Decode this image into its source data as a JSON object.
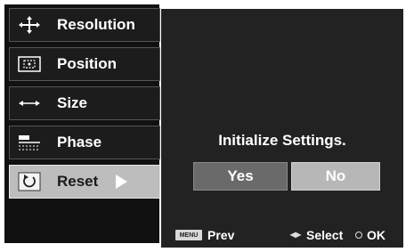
{
  "menu": {
    "items": [
      {
        "label": "Resolution",
        "icon": "resolution-icon"
      },
      {
        "label": "Position",
        "icon": "position-icon"
      },
      {
        "label": "Size",
        "icon": "size-icon"
      },
      {
        "label": "Phase",
        "icon": "phase-icon"
      },
      {
        "label": "Reset",
        "icon": "reset-icon",
        "selected": true
      }
    ]
  },
  "dialog": {
    "message": "Initialize Settings.",
    "yes_label": "Yes",
    "no_label": "No"
  },
  "footer": {
    "menu_key": "MENU",
    "prev_label": "Prev",
    "select_label": "Select",
    "ok_label": "OK"
  },
  "colors": {
    "menu_bg": "#111111",
    "item_bg": "#1c1c1c",
    "selected_bg": "#bdbdbd",
    "panel_bg": "#222222",
    "yes_bg": "#6a6a6a",
    "no_bg": "#b7b7b7"
  }
}
